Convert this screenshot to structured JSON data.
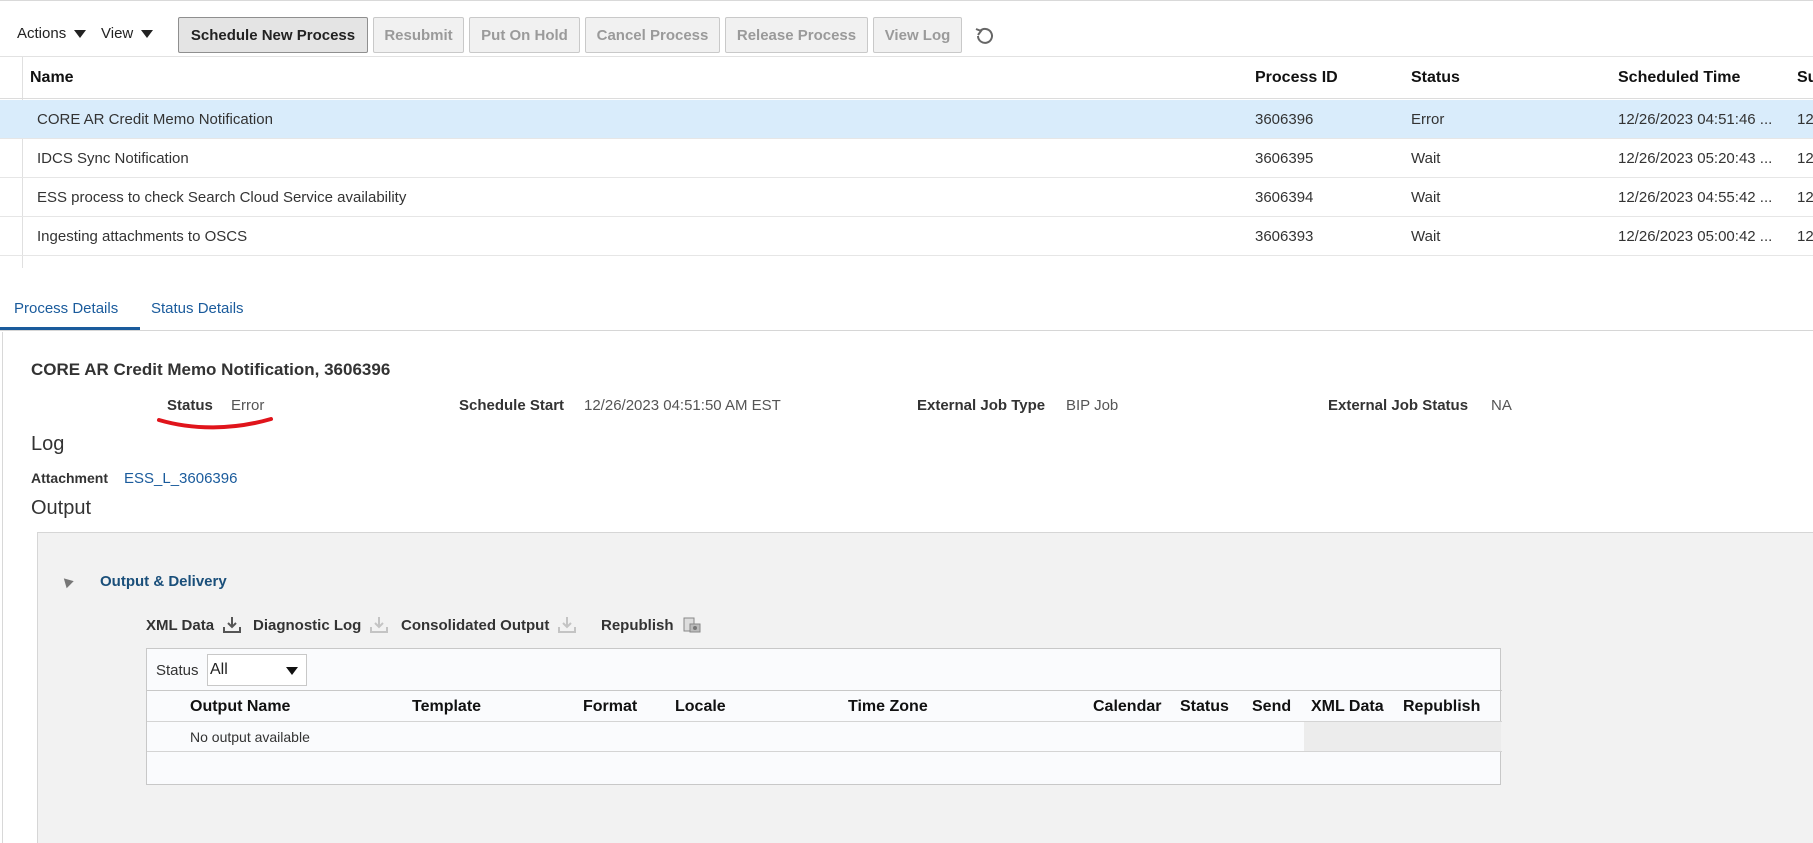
{
  "toolbar": {
    "actions_label": "Actions",
    "view_label": "View",
    "buttons": [
      "Schedule New Process",
      "Resubmit",
      "Put On Hold",
      "Cancel Process",
      "Release Process",
      "View Log"
    ]
  },
  "process_table": {
    "columns": [
      "Name",
      "Process ID",
      "Status",
      "Scheduled Time",
      "Su"
    ],
    "rows": [
      {
        "name": "CORE AR Credit Memo Notification",
        "id": "3606396",
        "status": "Error",
        "time": "12/26/2023 04:51:46 ...",
        "sub": "12"
      },
      {
        "name": "IDCS Sync Notification",
        "id": "3606395",
        "status": "Wait",
        "time": "12/26/2023 05:20:43 ...",
        "sub": "12"
      },
      {
        "name": "ESS process to check Search Cloud Service availability",
        "id": "3606394",
        "status": "Wait",
        "time": "12/26/2023 04:55:42 ...",
        "sub": "12"
      },
      {
        "name": "Ingesting attachments to OSCS",
        "id": "3606393",
        "status": "Wait",
        "time": "12/26/2023 05:00:42 ...",
        "sub": "12"
      }
    ]
  },
  "tabs": [
    "Process Details",
    "Status Details"
  ],
  "details": {
    "title": "CORE AR Credit Memo Notification, 3606396",
    "status_label": "Status",
    "status_value": "Error",
    "schedule_start_label": "Schedule Start",
    "schedule_start_value": "12/26/2023 04:51:50 AM EST",
    "ext_type_label": "External Job Type",
    "ext_type_value": "BIP Job",
    "ext_status_label": "External Job Status",
    "ext_status_value": "NA",
    "log_heading": "Log",
    "attachment_label": "Attachment",
    "attachment_value": "ESS_L_3606396",
    "output_heading": "Output"
  },
  "output_delivery": {
    "title": "Output & Delivery",
    "downloads": [
      "XML Data",
      "Diagnostic Log",
      "Consolidated Output",
      "Republish"
    ],
    "filter_label": "Status",
    "filter_value": "All",
    "columns": [
      "Output Name",
      "Template",
      "Format",
      "Locale",
      "Time Zone",
      "Calendar",
      "Status",
      "Send",
      "XML Data",
      "Republish"
    ],
    "empty_text": "No output available"
  },
  "colors": {
    "accent": "#1a5b9c",
    "selected_row": "#d9ecfb",
    "annotation": "#e0141b"
  }
}
